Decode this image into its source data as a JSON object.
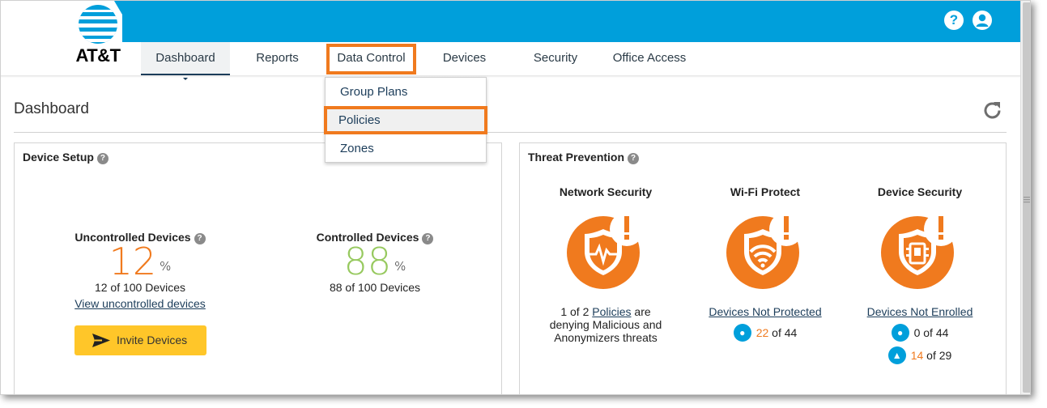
{
  "brand": {
    "logo_text": "AT&T",
    "accent": "#009fdb",
    "highlight": "#f07a1e"
  },
  "header": {
    "help_icon": "help-icon",
    "help_glyph": "?",
    "account_icon": "user-account-icon"
  },
  "nav": {
    "items": [
      {
        "label": "Dashboard",
        "active": true
      },
      {
        "label": "Reports"
      },
      {
        "label": "Data Control",
        "highlighted": true
      },
      {
        "label": "Devices"
      },
      {
        "label": "Security"
      },
      {
        "label": "Office Access"
      }
    ]
  },
  "dropdown": {
    "items": [
      {
        "label": "Group Plans"
      },
      {
        "label": "Policies",
        "highlighted": true
      },
      {
        "label": "Zones"
      }
    ]
  },
  "page": {
    "title": "Dashboard",
    "refresh_icon": "refresh-icon"
  },
  "device_setup": {
    "title": "Device Setup",
    "help_glyph": "?",
    "uncontrolled": {
      "label": "Uncontrolled Devices",
      "value": "12",
      "unit": "%",
      "sub": "12 of 100 Devices",
      "link": "View uncontrolled devices"
    },
    "controlled": {
      "label": "Controlled Devices",
      "value": "88",
      "unit": "%",
      "sub": "88 of 100 Devices"
    },
    "invite_button": "Invite Devices"
  },
  "threat_prevention": {
    "title": "Threat Prevention",
    "help_glyph": "?",
    "network": {
      "title": "Network Security",
      "text_1": "1 of 2 ",
      "text_link": "Policies",
      "text_2": " are denying Malicious and Anonymizers threats"
    },
    "wifi": {
      "title": "Wi-Fi Protect",
      "link": "Devices Not Protected",
      "ios_count": "22",
      "ios_total": " of 44"
    },
    "device": {
      "title": "Device Security",
      "link": "Devices Not Enrolled",
      "ios_count": "0 of 44",
      "android_count": "14",
      "android_total": " of 29"
    }
  }
}
